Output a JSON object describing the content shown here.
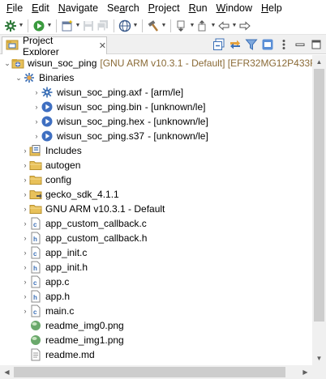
{
  "menubar": {
    "items": [
      {
        "label": "File",
        "mnemonic": "F",
        "rest": "ile"
      },
      {
        "label": "Edit",
        "mnemonic": "E",
        "rest": "dit"
      },
      {
        "label": "Navigate",
        "mnemonic": "N",
        "rest": "avigate"
      },
      {
        "label": "Search",
        "mnemonic": "a",
        "prefix": "Se",
        "rest": "rch"
      },
      {
        "label": "Project",
        "mnemonic": "P",
        "rest": "roject"
      },
      {
        "label": "Run",
        "mnemonic": "R",
        "rest": "un"
      },
      {
        "label": "Window",
        "mnemonic": "W",
        "rest": "indow"
      },
      {
        "label": "Help",
        "mnemonic": "H",
        "rest": "elp"
      }
    ]
  },
  "view": {
    "tab_title": "Project Explorer",
    "close_glyph": "✕"
  },
  "tree": {
    "project": {
      "name": "wisun_soc_ping",
      "decoration": "[GNU ARM v10.3.1 - Default] [EFR32MG12P433F"
    },
    "binaries": {
      "label": "Binaries",
      "items": [
        {
          "name": "wisun_soc_ping.axf",
          "decoration": "- [arm/le]",
          "icon": "gear-binary-icon"
        },
        {
          "name": "wisun_soc_ping.bin",
          "decoration": "- [unknown/le]",
          "icon": "run-binary-icon"
        },
        {
          "name": "wisun_soc_ping.hex",
          "decoration": "- [unknown/le]",
          "icon": "run-binary-icon"
        },
        {
          "name": "wisun_soc_ping.s37",
          "decoration": "- [unknown/le]",
          "icon": "run-binary-icon"
        }
      ]
    },
    "children": [
      {
        "label": "Includes",
        "icon": "includes-icon",
        "expandable": true
      },
      {
        "label": "autogen",
        "icon": "folder-icon",
        "expandable": true
      },
      {
        "label": "config",
        "icon": "folder-icon",
        "expandable": true
      },
      {
        "label": "gecko_sdk_4.1.1",
        "icon": "linked-folder-icon",
        "expandable": true
      },
      {
        "label": "GNU ARM v10.3.1 - Default",
        "icon": "folder-icon",
        "expandable": true
      },
      {
        "label": "app_custom_callback.c",
        "icon": "c-file-icon",
        "expandable": true
      },
      {
        "label": "app_custom_callback.h",
        "icon": "h-file-icon",
        "expandable": true
      },
      {
        "label": "app_init.c",
        "icon": "c-file-icon",
        "expandable": true
      },
      {
        "label": "app_init.h",
        "icon": "h-file-icon",
        "expandable": true
      },
      {
        "label": "app.c",
        "icon": "c-file-icon",
        "expandable": true
      },
      {
        "label": "app.h",
        "icon": "h-file-icon",
        "expandable": true
      },
      {
        "label": "main.c",
        "icon": "c-file-icon",
        "expandable": true
      },
      {
        "label": "readme_img0.png",
        "icon": "image-file-icon",
        "expandable": false
      },
      {
        "label": "readme_img1.png",
        "icon": "image-file-icon",
        "expandable": false
      },
      {
        "label": "readme.md",
        "icon": "markdown-file-icon",
        "expandable": false
      }
    ]
  },
  "colors": {
    "decoration": "#8a6a36",
    "folder": "#e8c15a",
    "c_file": "#3b6fb6",
    "h_file": "#3b6fb6",
    "scroll_thumb": "#cdcdcd"
  }
}
